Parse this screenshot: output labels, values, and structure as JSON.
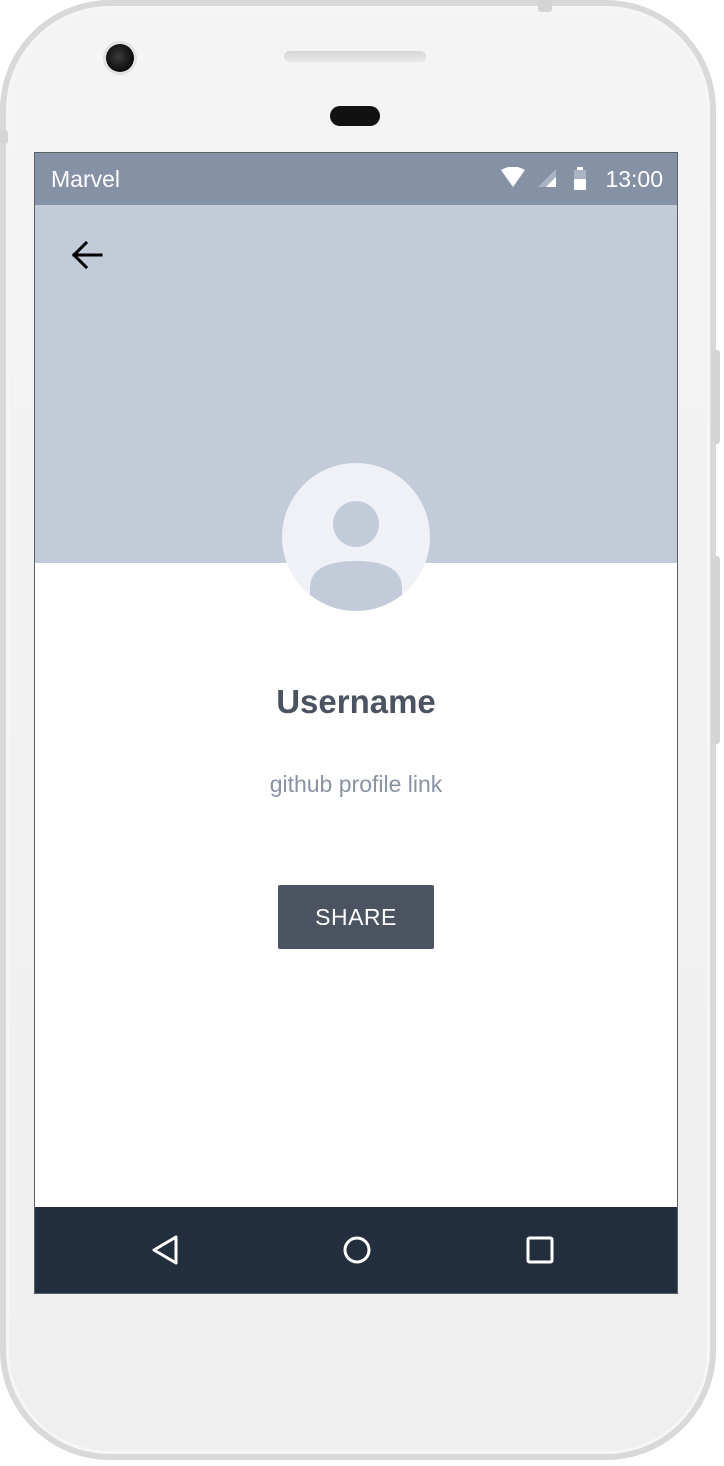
{
  "status_bar": {
    "app_name": "Marvel",
    "time": "13:00",
    "icons": [
      "wifi-icon",
      "signal-icon",
      "battery-icon"
    ]
  },
  "header": {
    "back_icon": "arrow-left-icon"
  },
  "profile": {
    "avatar_icon": "user-avatar-icon",
    "username": "Username",
    "profile_link": "github profile link"
  },
  "actions": {
    "share_label": "SHARE"
  },
  "nav_bar": {
    "icons": [
      "back-triangle-icon",
      "home-circle-icon",
      "recents-square-icon"
    ]
  },
  "colors": {
    "status_bar": "#8591a4",
    "header": "#c2cbd7",
    "avatar_bg": "#eff1f6",
    "username_text": "#4b5261",
    "link_text": "#8a93a3",
    "share_button": "#4d5461",
    "nav_bar": "#222d3d"
  }
}
